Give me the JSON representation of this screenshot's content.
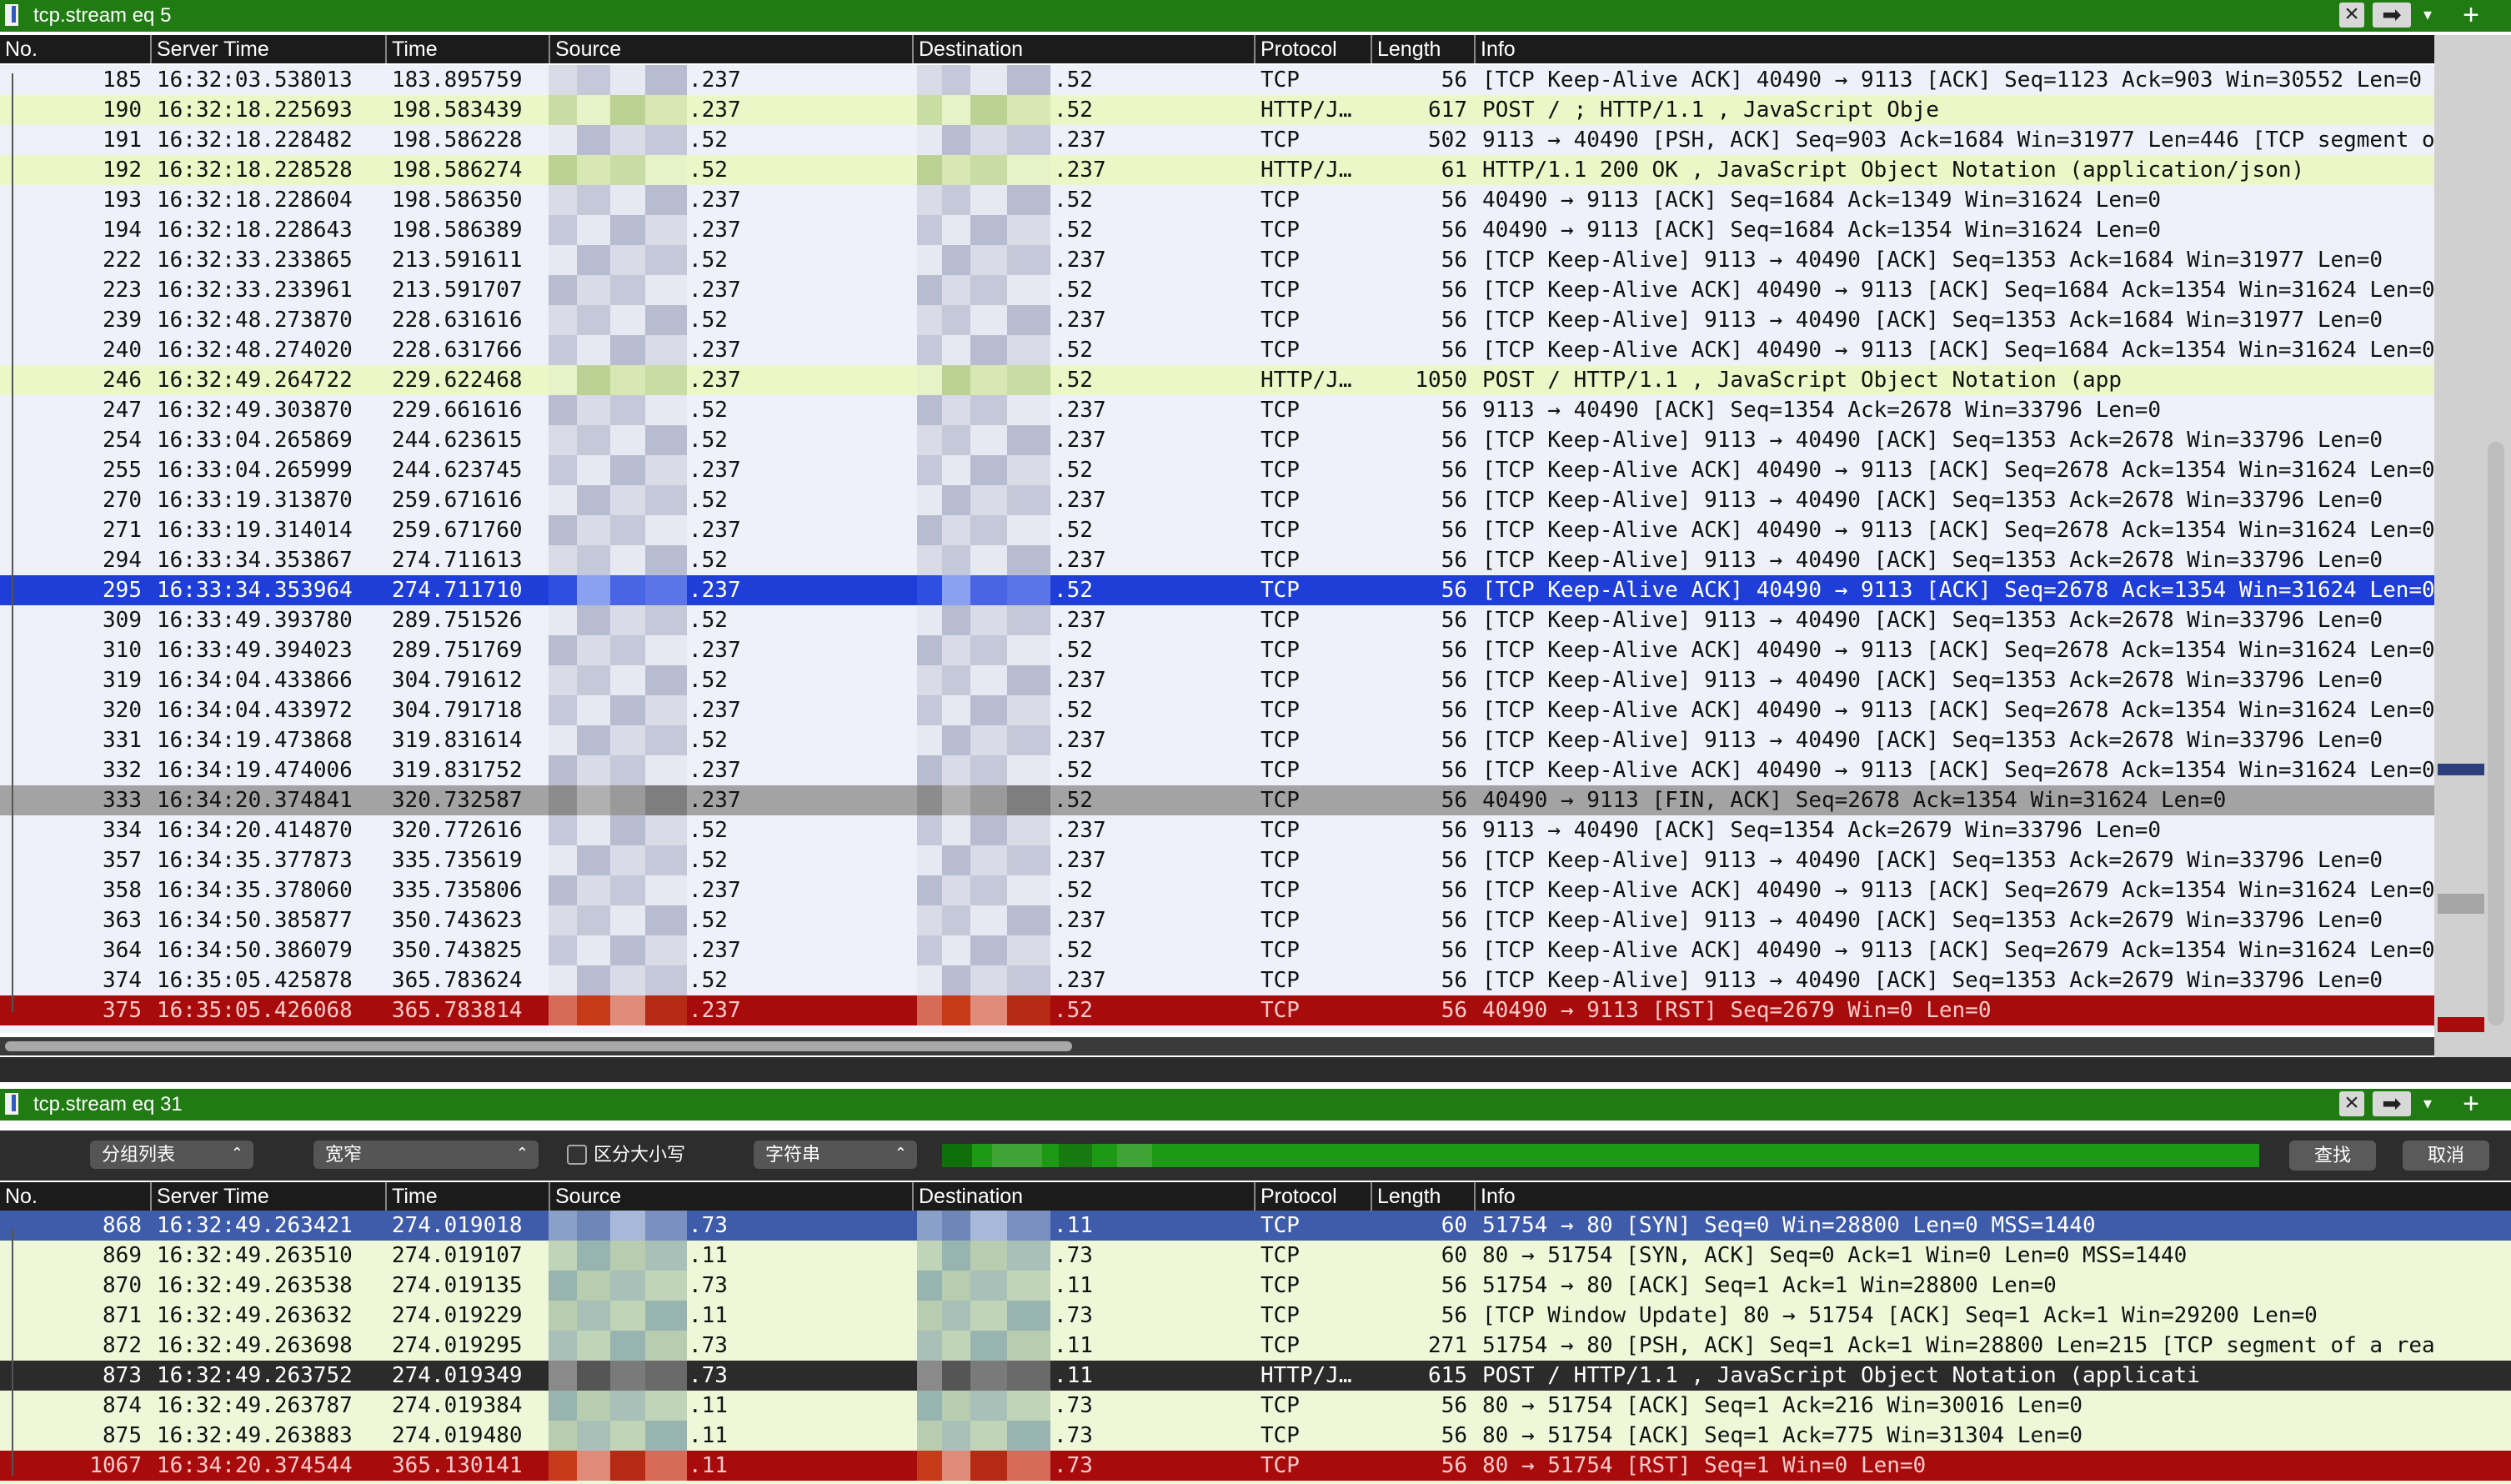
{
  "filter1": {
    "text": "tcp.stream eq 5"
  },
  "filter2": {
    "text": "tcp.stream eq 31"
  },
  "columns": [
    "No.",
    "Server Time",
    "Time",
    "Source",
    "Destination",
    "Protocol",
    "Length",
    "Info"
  ],
  "table1": [
    {
      "no": "185",
      "stime": "16:32:03.538013",
      "time": "183.895759",
      "src": ".237",
      "dst": ".52",
      "proto": "TCP",
      "len": "56",
      "info": "[TCP Keep-Alive ACK] 40490 → 9113 [ACK] Seq=1123 Ack=903 Win=30552 Len=0",
      "style": "tcp"
    },
    {
      "no": "190",
      "stime": "16:32:18.225693",
      "time": "198.583439",
      "src": ".237",
      "dst": ".52",
      "proto": "HTTP/J…",
      "len": "617",
      "info": "POST /                                    ; HTTP/1.1 , JavaScript Obje",
      "style": "http"
    },
    {
      "no": "191",
      "stime": "16:32:18.228482",
      "time": "198.586228",
      "src": ".52",
      "dst": ".237",
      "proto": "TCP",
      "len": "502",
      "info": "9113 → 40490 [PSH, ACK] Seq=903 Ack=1684 Win=31977 Len=446 [TCP segment o",
      "style": "tcp"
    },
    {
      "no": "192",
      "stime": "16:32:18.228528",
      "time": "198.586274",
      "src": ".52",
      "dst": ".237",
      "proto": "HTTP/J…",
      "len": "61",
      "info": "HTTP/1.1 200 OK , JavaScript Object Notation (application/json)",
      "style": "http"
    },
    {
      "no": "193",
      "stime": "16:32:18.228604",
      "time": "198.586350",
      "src": ".237",
      "dst": ".52",
      "proto": "TCP",
      "len": "56",
      "info": "40490 → 9113 [ACK] Seq=1684 Ack=1349 Win=31624 Len=0",
      "style": "tcp"
    },
    {
      "no": "194",
      "stime": "16:32:18.228643",
      "time": "198.586389",
      "src": ".237",
      "dst": ".52",
      "proto": "TCP",
      "len": "56",
      "info": "40490 → 9113 [ACK] Seq=1684 Ack=1354 Win=31624 Len=0",
      "style": "tcp"
    },
    {
      "no": "222",
      "stime": "16:32:33.233865",
      "time": "213.591611",
      "src": ".52",
      "dst": ".237",
      "proto": "TCP",
      "len": "56",
      "info": "[TCP Keep-Alive] 9113 → 40490 [ACK] Seq=1353 Ack=1684 Win=31977 Len=0",
      "style": "tcp"
    },
    {
      "no": "223",
      "stime": "16:32:33.233961",
      "time": "213.591707",
      "src": ".237",
      "dst": ".52",
      "proto": "TCP",
      "len": "56",
      "info": "[TCP Keep-Alive ACK] 40490 → 9113 [ACK] Seq=1684 Ack=1354 Win=31624 Len=0",
      "style": "tcp"
    },
    {
      "no": "239",
      "stime": "16:32:48.273870",
      "time": "228.631616",
      "src": ".52",
      "dst": ".237",
      "proto": "TCP",
      "len": "56",
      "info": "[TCP Keep-Alive] 9113 → 40490 [ACK] Seq=1353 Ack=1684 Win=31977 Len=0",
      "style": "tcp"
    },
    {
      "no": "240",
      "stime": "16:32:48.274020",
      "time": "228.631766",
      "src": ".237",
      "dst": ".52",
      "proto": "TCP",
      "len": "56",
      "info": "[TCP Keep-Alive ACK] 40490 → 9113 [ACK] Seq=1684 Ack=1354 Win=31624 Len=0",
      "style": "tcp"
    },
    {
      "no": "246",
      "stime": "16:32:49.264722",
      "time": "229.622468",
      "src": ".237",
      "dst": ".52",
      "proto": "HTTP/J…",
      "len": "1050",
      "info": "POST /                          HTTP/1.1 , JavaScript Object Notation (app",
      "style": "http"
    },
    {
      "no": "247",
      "stime": "16:32:49.303870",
      "time": "229.661616",
      "src": ".52",
      "dst": ".237",
      "proto": "TCP",
      "len": "56",
      "info": "9113 → 40490 [ACK] Seq=1354 Ack=2678 Win=33796 Len=0",
      "style": "tcp"
    },
    {
      "no": "254",
      "stime": "16:33:04.265869",
      "time": "244.623615",
      "src": ".52",
      "dst": ".237",
      "proto": "TCP",
      "len": "56",
      "info": "[TCP Keep-Alive] 9113 → 40490 [ACK] Seq=1353 Ack=2678 Win=33796 Len=0",
      "style": "tcp"
    },
    {
      "no": "255",
      "stime": "16:33:04.265999",
      "time": "244.623745",
      "src": ".237",
      "dst": ".52",
      "proto": "TCP",
      "len": "56",
      "info": "[TCP Keep-Alive ACK] 40490 → 9113 [ACK] Seq=2678 Ack=1354 Win=31624 Len=0",
      "style": "tcp"
    },
    {
      "no": "270",
      "stime": "16:33:19.313870",
      "time": "259.671616",
      "src": ".52",
      "dst": ".237",
      "proto": "TCP",
      "len": "56",
      "info": "[TCP Keep-Alive] 9113 → 40490 [ACK] Seq=1353 Ack=2678 Win=33796 Len=0",
      "style": "tcp"
    },
    {
      "no": "271",
      "stime": "16:33:19.314014",
      "time": "259.671760",
      "src": ".237",
      "dst": ".52",
      "proto": "TCP",
      "len": "56",
      "info": "[TCP Keep-Alive ACK] 40490 → 9113 [ACK] Seq=2678 Ack=1354 Win=31624 Len=0",
      "style": "tcp"
    },
    {
      "no": "294",
      "stime": "16:33:34.353867",
      "time": "274.711613",
      "src": ".52",
      "dst": ".237",
      "proto": "TCP",
      "len": "56",
      "info": "[TCP Keep-Alive] 9113 → 40490 [ACK] Seq=1353 Ack=2678 Win=33796 Len=0",
      "style": "tcp"
    },
    {
      "no": "295",
      "stime": "16:33:34.353964",
      "time": "274.711710",
      "src": ".237",
      "dst": ".52",
      "proto": "TCP",
      "len": "56",
      "info": "[TCP Keep-Alive ACK] 40490 → 9113 [ACK] Seq=2678 Ack=1354 Win=31624 Len=0",
      "style": "sel"
    },
    {
      "no": "309",
      "stime": "16:33:49.393780",
      "time": "289.751526",
      "src": ".52",
      "dst": ".237",
      "proto": "TCP",
      "len": "56",
      "info": "[TCP Keep-Alive] 9113 → 40490 [ACK] Seq=1353 Ack=2678 Win=33796 Len=0",
      "style": "tcp"
    },
    {
      "no": "310",
      "stime": "16:33:49.394023",
      "time": "289.751769",
      "src": ".237",
      "dst": ".52",
      "proto": "TCP",
      "len": "56",
      "info": "[TCP Keep-Alive ACK] 40490 → 9113 [ACK] Seq=2678 Ack=1354 Win=31624 Len=0",
      "style": "tcp"
    },
    {
      "no": "319",
      "stime": "16:34:04.433866",
      "time": "304.791612",
      "src": ".52",
      "dst": ".237",
      "proto": "TCP",
      "len": "56",
      "info": "[TCP Keep-Alive] 9113 → 40490 [ACK] Seq=1353 Ack=2678 Win=33796 Len=0",
      "style": "tcp"
    },
    {
      "no": "320",
      "stime": "16:34:04.433972",
      "time": "304.791718",
      "src": ".237",
      "dst": ".52",
      "proto": "TCP",
      "len": "56",
      "info": "[TCP Keep-Alive ACK] 40490 → 9113 [ACK] Seq=2678 Ack=1354 Win=31624 Len=0",
      "style": "tcp"
    },
    {
      "no": "331",
      "stime": "16:34:19.473868",
      "time": "319.831614",
      "src": ".52",
      "dst": ".237",
      "proto": "TCP",
      "len": "56",
      "info": "[TCP Keep-Alive] 9113 → 40490 [ACK] Seq=1353 Ack=2678 Win=33796 Len=0",
      "style": "tcp"
    },
    {
      "no": "332",
      "stime": "16:34:19.474006",
      "time": "319.831752",
      "src": ".237",
      "dst": ".52",
      "proto": "TCP",
      "len": "56",
      "info": "[TCP Keep-Alive ACK] 40490 → 9113 [ACK] Seq=2678 Ack=1354 Win=31624 Len=0",
      "style": "tcp"
    },
    {
      "no": "333",
      "stime": "16:34:20.374841",
      "time": "320.732587",
      "src": ".237",
      "dst": ".52",
      "proto": "TCP",
      "len": "56",
      "info": "40490 → 9113 [FIN, ACK] Seq=2678 Ack=1354 Win=31624 Len=0",
      "style": "fin"
    },
    {
      "no": "334",
      "stime": "16:34:20.414870",
      "time": "320.772616",
      "src": ".52",
      "dst": ".237",
      "proto": "TCP",
      "len": "56",
      "info": "9113 → 40490 [ACK] Seq=1354 Ack=2679 Win=33796 Len=0",
      "style": "tcp"
    },
    {
      "no": "357",
      "stime": "16:34:35.377873",
      "time": "335.735619",
      "src": ".52",
      "dst": ".237",
      "proto": "TCP",
      "len": "56",
      "info": "[TCP Keep-Alive] 9113 → 40490 [ACK] Seq=1353 Ack=2679 Win=33796 Len=0",
      "style": "tcp"
    },
    {
      "no": "358",
      "stime": "16:34:35.378060",
      "time": "335.735806",
      "src": ".237",
      "dst": ".52",
      "proto": "TCP",
      "len": "56",
      "info": "[TCP Keep-Alive ACK] 40490 → 9113 [ACK] Seq=2679 Ack=1354 Win=31624 Len=0",
      "style": "tcp"
    },
    {
      "no": "363",
      "stime": "16:34:50.385877",
      "time": "350.743623",
      "src": ".52",
      "dst": ".237",
      "proto": "TCP",
      "len": "56",
      "info": "[TCP Keep-Alive] 9113 → 40490 [ACK] Seq=1353 Ack=2679 Win=33796 Len=0",
      "style": "tcp"
    },
    {
      "no": "364",
      "stime": "16:34:50.386079",
      "time": "350.743825",
      "src": ".237",
      "dst": ".52",
      "proto": "TCP",
      "len": "56",
      "info": "[TCP Keep-Alive ACK] 40490 → 9113 [ACK] Seq=2679 Ack=1354 Win=31624 Len=0",
      "style": "tcp"
    },
    {
      "no": "374",
      "stime": "16:35:05.425878",
      "time": "365.783624",
      "src": ".52",
      "dst": ".237",
      "proto": "TCP",
      "len": "56",
      "info": "[TCP Keep-Alive] 9113 → 40490 [ACK] Seq=1353 Ack=2679 Win=33796 Len=0",
      "style": "tcp"
    },
    {
      "no": "375",
      "stime": "16:35:05.426068",
      "time": "365.783814",
      "src": ".237",
      "dst": ".52",
      "proto": "TCP",
      "len": "56",
      "info": "40490 → 9113 [RST] Seq=2679 Win=0 Len=0",
      "style": "rst"
    }
  ],
  "toolbar": {
    "mode": "分组列表",
    "charset": "宽窄",
    "case_label": "区分大小写",
    "type": "字符串",
    "find": "查找",
    "cancel": "取消"
  },
  "table2": [
    {
      "no": "868",
      "stime": "16:32:49.263421",
      "time": "274.019018",
      "src": ".73",
      "dst": ".11",
      "proto": "TCP",
      "len": "60",
      "info": "51754 → 80 [SYN] Seq=0 Win=28800 Len=0 MSS=1440",
      "style": "first"
    },
    {
      "no": "869",
      "stime": "16:32:49.263510",
      "time": "274.019107",
      "src": ".11",
      "dst": ".73",
      "proto": "TCP",
      "len": "60",
      "info": "80 → 51754 [SYN, ACK] Seq=0 Ack=1 Win=0 Len=0 MSS=1440",
      "style": "light2"
    },
    {
      "no": "870",
      "stime": "16:32:49.263538",
      "time": "274.019135",
      "src": ".73",
      "dst": ".11",
      "proto": "TCP",
      "len": "56",
      "info": "51754 → 80 [ACK] Seq=1 Ack=1 Win=28800 Len=0",
      "style": "light2"
    },
    {
      "no": "871",
      "stime": "16:32:49.263632",
      "time": "274.019229",
      "src": ".11",
      "dst": ".73",
      "proto": "TCP",
      "len": "56",
      "info": "[TCP Window Update] 80 → 51754 [ACK] Seq=1 Ack=1 Win=29200 Len=0",
      "style": "light2"
    },
    {
      "no": "872",
      "stime": "16:32:49.263698",
      "time": "274.019295",
      "src": ".73",
      "dst": ".11",
      "proto": "TCP",
      "len": "271",
      "info": "51754 → 80 [PSH, ACK] Seq=1 Ack=1 Win=28800 Len=215 [TCP segment of a reassembl",
      "style": "light2"
    },
    {
      "no": "873",
      "stime": "16:32:49.263752",
      "time": "274.019349",
      "src": ".73",
      "dst": ".11",
      "proto": "HTTP/J…",
      "len": "615",
      "info": "POST /                          HTTP/1.1 , JavaScript Object Notation (applicati",
      "style": "dark"
    },
    {
      "no": "874",
      "stime": "16:32:49.263787",
      "time": "274.019384",
      "src": ".11",
      "dst": ".73",
      "proto": "TCP",
      "len": "56",
      "info": "80 → 51754 [ACK] Seq=1 Ack=216 Win=30016 Len=0",
      "style": "light2"
    },
    {
      "no": "875",
      "stime": "16:32:49.263883",
      "time": "274.019480",
      "src": ".11",
      "dst": ".73",
      "proto": "TCP",
      "len": "56",
      "info": "80 → 51754 [ACK] Seq=1 Ack=775 Win=31304 Len=0",
      "style": "light2"
    },
    {
      "no": "1067",
      "stime": "16:34:20.374544",
      "time": "365.130141",
      "src": ".11",
      "dst": ".73",
      "proto": "TCP",
      "len": "56",
      "info": "80 → 51754 [RST] Seq=1 Win=0 Len=0",
      "style": "rst"
    }
  ]
}
